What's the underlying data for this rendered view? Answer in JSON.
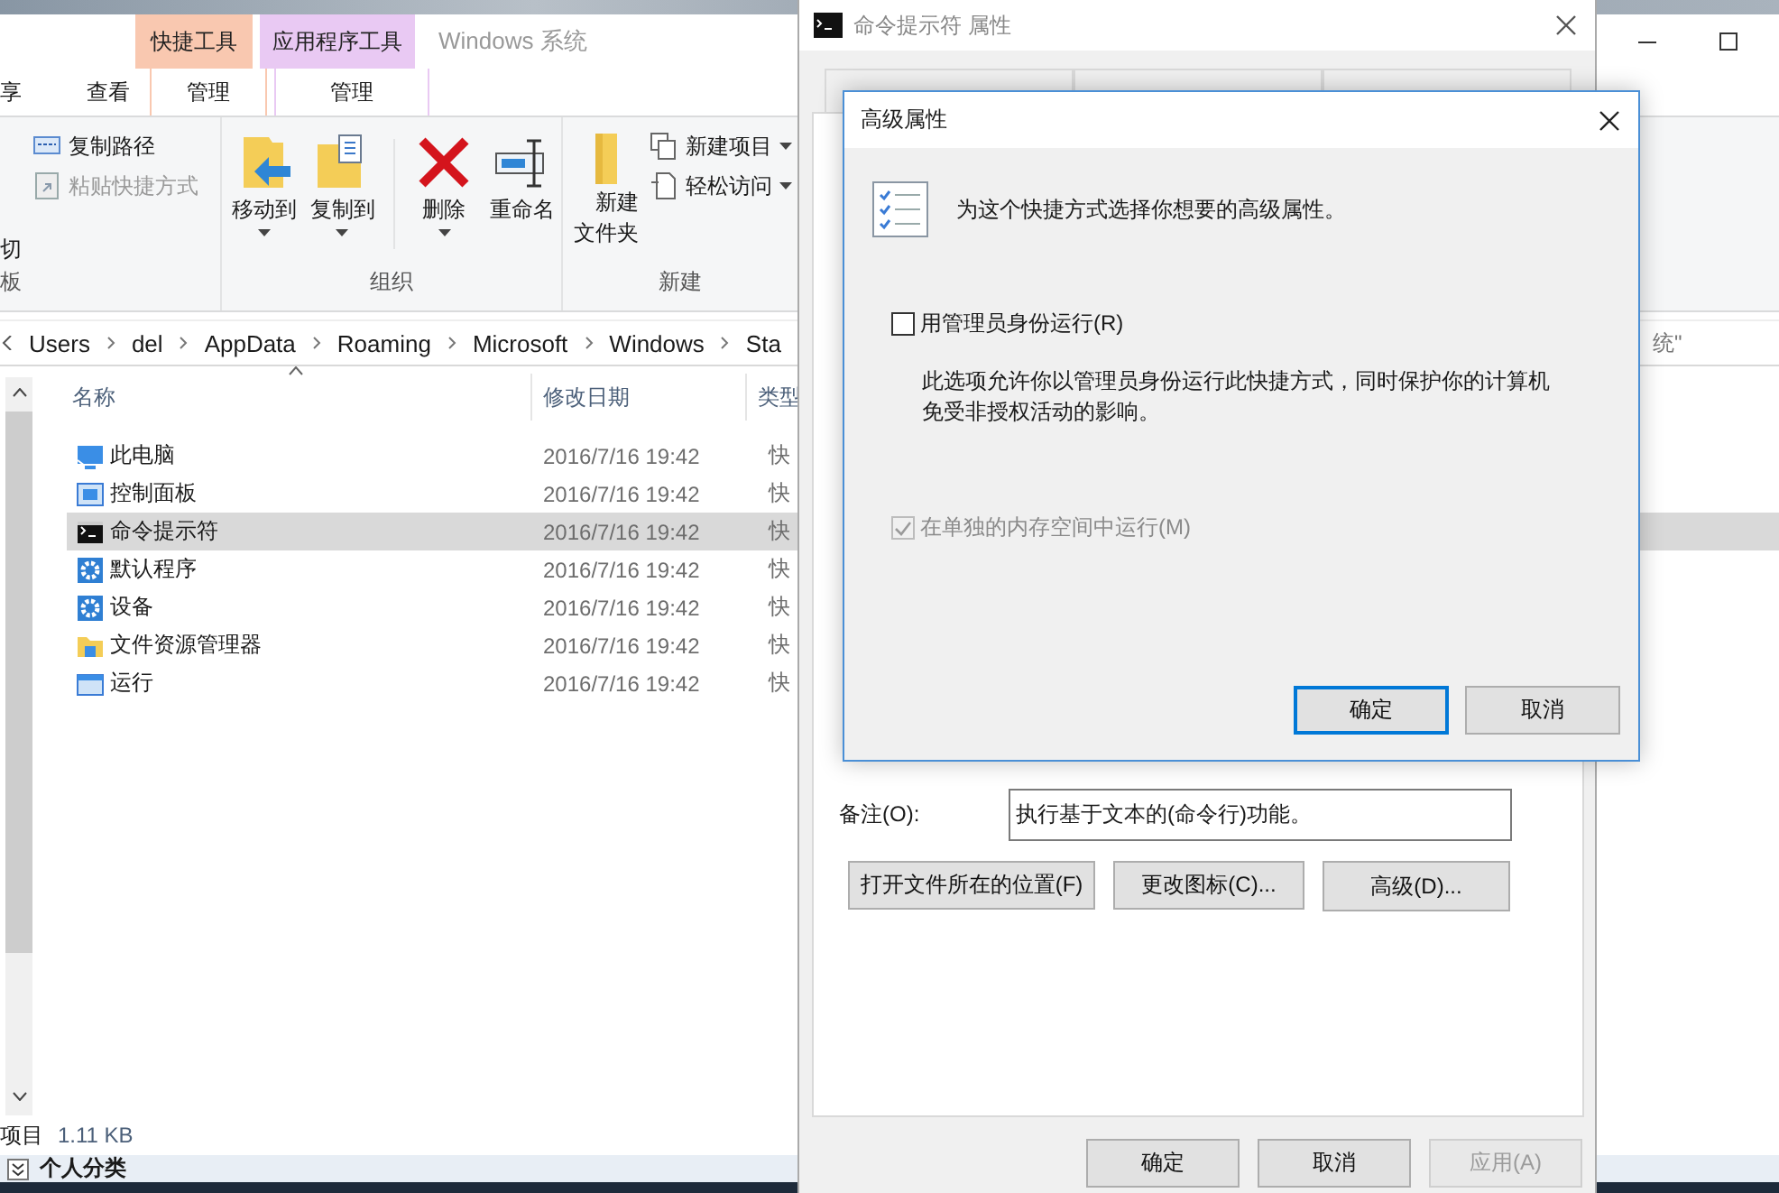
{
  "explorer": {
    "title": "Windows 系统",
    "context_tabs": [
      {
        "label": "快捷工具",
        "color": "#f9c8b0",
        "tab": "管理"
      },
      {
        "label": "应用程序工具",
        "color": "#e9c9f3",
        "tab": "管理"
      }
    ],
    "ribbon_tabs": [
      "享",
      "查看"
    ],
    "ribbon_groups": [
      {
        "label": "板",
        "items": [
          {
            "kind": "small",
            "label": "复制路径",
            "disabled": false,
            "dropdown": false
          },
          {
            "kind": "small",
            "label": "粘贴快捷方式",
            "disabled": true,
            "dropdown": false
          },
          {
            "kind": "cut",
            "label": "切",
            "disabled": false
          }
        ]
      },
      {
        "label": "组织",
        "items": [
          {
            "kind": "large",
            "label": "移动到",
            "disabled": false,
            "dropdown": true
          },
          {
            "kind": "large",
            "label": "复制到",
            "disabled": false,
            "dropdown": true
          },
          {
            "kind": "large",
            "label": "删除",
            "disabled": false,
            "dropdown": true
          },
          {
            "kind": "large",
            "label": "重命名",
            "disabled": false,
            "dropdown": false
          }
        ]
      },
      {
        "label": "新建",
        "items": [
          {
            "kind": "large",
            "label": "新建文件夹",
            "disabled": false,
            "dropdown": false
          },
          {
            "kind": "small",
            "label": "新建项目",
            "disabled": false,
            "dropdown": true
          },
          {
            "kind": "small",
            "label": "轻松访问",
            "disabled": false,
            "dropdown": true
          }
        ]
      }
    ],
    "breadcrumb": [
      "Users",
      "del",
      "AppData",
      "Roaming",
      "Microsoft",
      "Windows",
      "Sta"
    ],
    "search": {
      "placeholder": "统\""
    },
    "columns": [
      "名称",
      "修改日期",
      "类型"
    ],
    "files": [
      {
        "name": "此电脑",
        "date": "2016/7/16 19:42",
        "type": "快",
        "selected": false
      },
      {
        "name": "控制面板",
        "date": "2016/7/16 19:42",
        "type": "快",
        "selected": false
      },
      {
        "name": "命令提示符",
        "date": "2016/7/16 19:42",
        "type": "快",
        "selected": true
      },
      {
        "name": "默认程序",
        "date": "2016/7/16 19:42",
        "type": "快",
        "selected": false
      },
      {
        "name": "设备",
        "date": "2016/7/16 19:42",
        "type": "快",
        "selected": false
      },
      {
        "name": "文件资源管理器",
        "date": "2016/7/16 19:42",
        "type": "快",
        "selected": false
      },
      {
        "name": "运行",
        "date": "2016/7/16 19:42",
        "type": "快",
        "selected": false
      }
    ],
    "status": {
      "count": "项目",
      "size": "1.11 KB"
    }
  },
  "background_window": {
    "title": "个人分类"
  },
  "properties": {
    "title": "命令提示符 属性",
    "comment_label": "备注(O):",
    "comment": "执行基于文本的(命令行)功能。",
    "actions": [
      "打开文件所在的位置(F)",
      "更改图标(C)...",
      "高级(D)..."
    ],
    "buttons": [
      {
        "label": "确定",
        "disabled": false
      },
      {
        "label": "取消",
        "disabled": false
      },
      {
        "label": "应用(A)",
        "disabled": true
      }
    ]
  },
  "advanced": {
    "title": "高级属性",
    "intro": "为这个快捷方式选择你想要的高级属性。",
    "options": [
      {
        "label": "用管理员身份运行(R)",
        "checked": false,
        "disabled": false,
        "description": "此选项允许你以管理员身份运行此快捷方式，同时保护你的计算机免受非授权活动的影响。"
      },
      {
        "label": "在单独的内存空间中运行(M)",
        "checked": true,
        "disabled": true
      }
    ],
    "buttons": [
      {
        "label": "确定",
        "default": true
      },
      {
        "label": "取消",
        "default": false
      }
    ]
  }
}
